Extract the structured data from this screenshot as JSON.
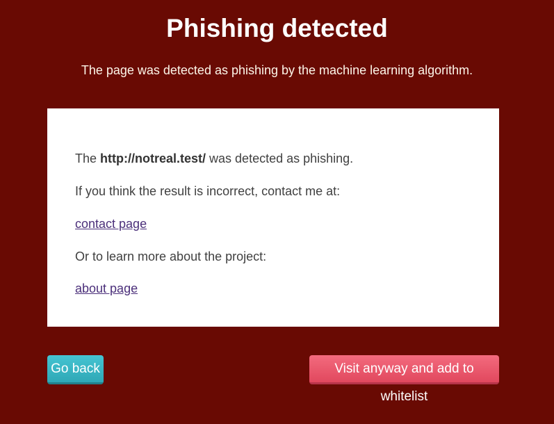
{
  "header": {
    "title": "Phishing detected",
    "subtitle": "The page was detected as phishing by the machine learning algorithm."
  },
  "card": {
    "line1_prefix": "The ",
    "url": "http://notreal.test/",
    "line1_suffix": " was detected as phishing.",
    "line2": "If you think the result is incorrect, contact me at:",
    "contact_link": "contact page",
    "line4": "Or to learn more about the project:",
    "about_link": "about page"
  },
  "buttons": {
    "back_label": "Go back",
    "visit_label": "Visit anyway and add to whitelist"
  },
  "colors": {
    "background": "#690a03",
    "back_button": "#3bb7c5",
    "visit_button": "#ea5a6e",
    "link": "#4b2f7a"
  }
}
